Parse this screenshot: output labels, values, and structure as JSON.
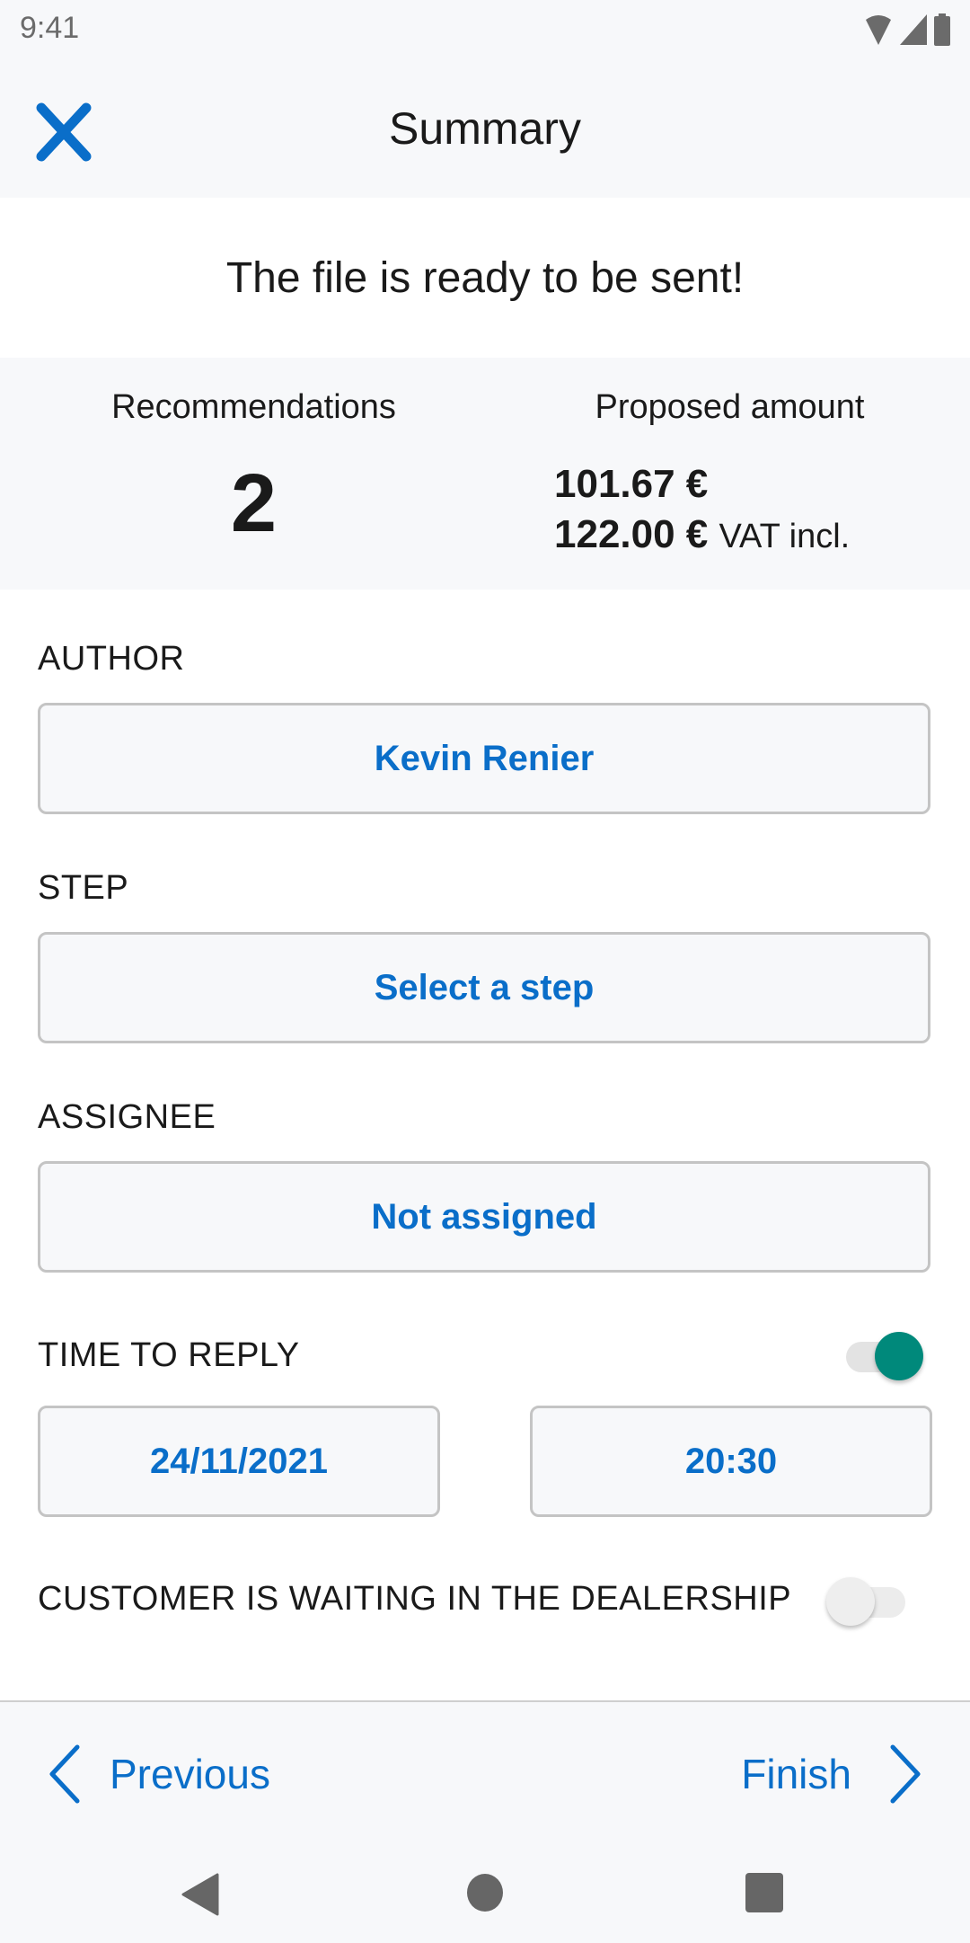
{
  "status_bar": {
    "time": "9:41",
    "icons": [
      "wifi-icon",
      "signal-icon",
      "battery-icon"
    ]
  },
  "app_bar": {
    "title": "Summary",
    "close_icon": "close-icon"
  },
  "ready_message": "The file is ready to be sent!",
  "summary": {
    "recommendations_label": "Recommendations",
    "recommendations_value": "2",
    "proposed_amount_label": "Proposed amount",
    "amount_excl": "101.67 €",
    "amount_incl": "122.00 €",
    "vat_suffix": "VAT incl."
  },
  "form": {
    "author": {
      "label": "AUTHOR",
      "value": "Kevin Renier"
    },
    "step": {
      "label": "STEP",
      "value": "Select a step"
    },
    "assignee": {
      "label": "ASSIGNEE",
      "value": "Not assigned"
    },
    "time_to_reply": {
      "label": "TIME TO REPLY",
      "enabled": true,
      "date": "24/11/2021",
      "time": "20:30"
    },
    "customer_waiting": {
      "label": "CUSTOMER IS WAITING IN THE DEALERSHIP",
      "enabled": false
    }
  },
  "footer": {
    "previous_label": "Previous",
    "finish_label": "Finish"
  },
  "system_nav": [
    "back-icon",
    "home-icon",
    "recents-icon"
  ],
  "colors": {
    "accent": "#0a6ec9",
    "toggle_on": "#00897b",
    "toggle_off": "#eeeeee",
    "surface": "#f7f8fa"
  }
}
